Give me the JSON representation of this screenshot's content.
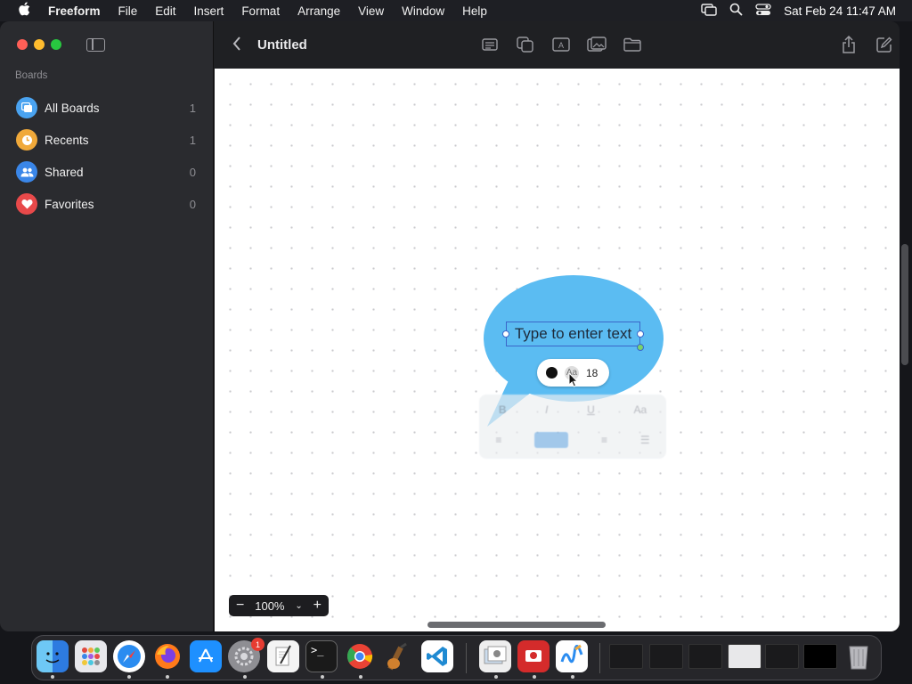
{
  "menubar": {
    "app": "Freeform",
    "items": [
      "File",
      "Edit",
      "Insert",
      "Format",
      "Arrange",
      "View",
      "Window",
      "Help"
    ],
    "datetime": "Sat Feb 24  11:47 AM"
  },
  "sidebar": {
    "heading": "Boards",
    "items": [
      {
        "label": "All Boards",
        "count": "1",
        "color": "#4aa3f0"
      },
      {
        "label": "Recents",
        "count": "1",
        "color": "#f0a93a"
      },
      {
        "label": "Shared",
        "count": "0",
        "color": "#3a86e8"
      },
      {
        "label": "Favorites",
        "count": "0",
        "color": "#e8494a"
      }
    ]
  },
  "toolbar": {
    "title": "Untitled"
  },
  "canvas": {
    "bubble_color": "#5bbcf2",
    "text_placeholder": "Type to enter text",
    "font_size": "18"
  },
  "zoom": {
    "value": "100%"
  },
  "dock": {
    "settings_badge": "1"
  }
}
